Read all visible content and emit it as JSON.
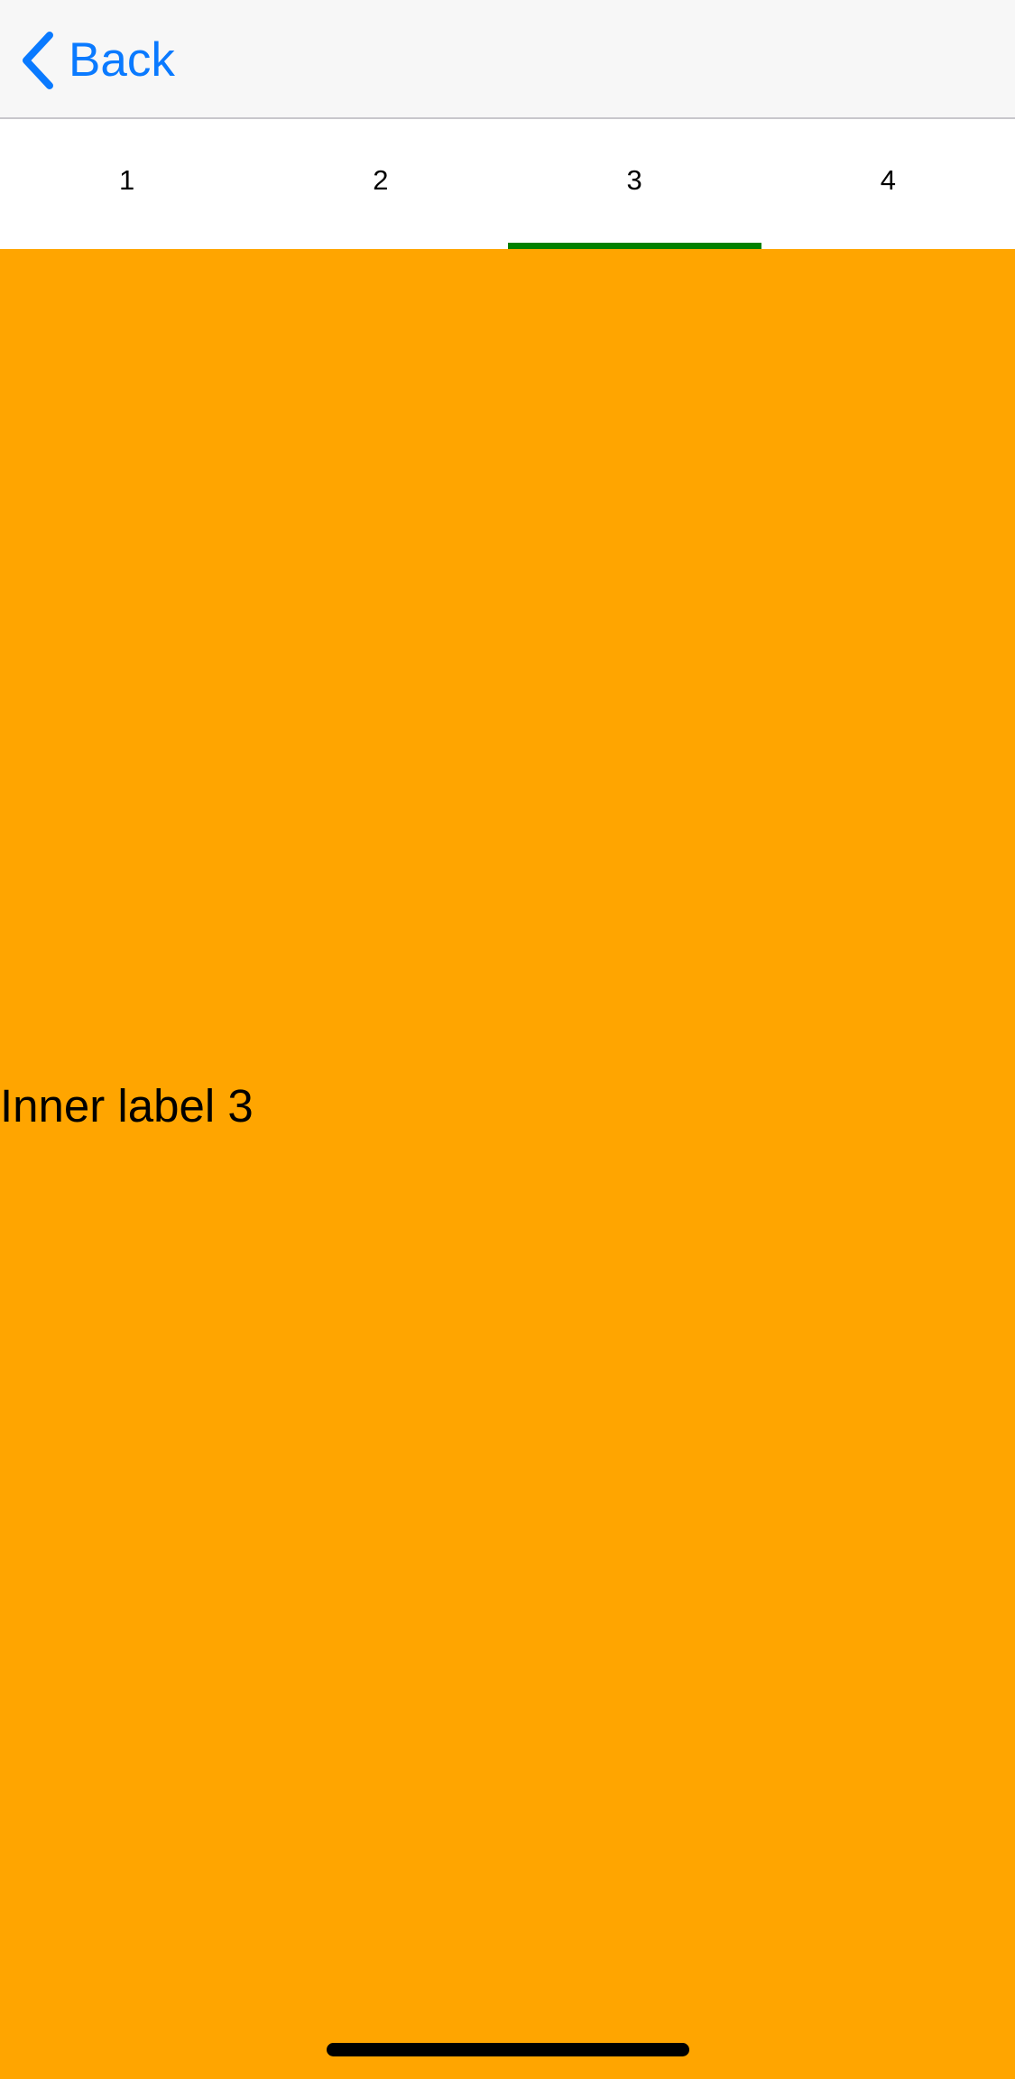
{
  "navbar": {
    "back_label": "Back",
    "back_icon": "chevron-left-icon",
    "accent_color": "#0A7AFF"
  },
  "tabs": [
    {
      "label": "1",
      "active": false
    },
    {
      "label": "2",
      "active": false
    },
    {
      "label": "3",
      "active": true
    },
    {
      "label": "4",
      "active": false
    }
  ],
  "tab_indicator_color": "#008000",
  "content": {
    "inner_label": "Inner label 3",
    "background_color": "#FFA500"
  }
}
